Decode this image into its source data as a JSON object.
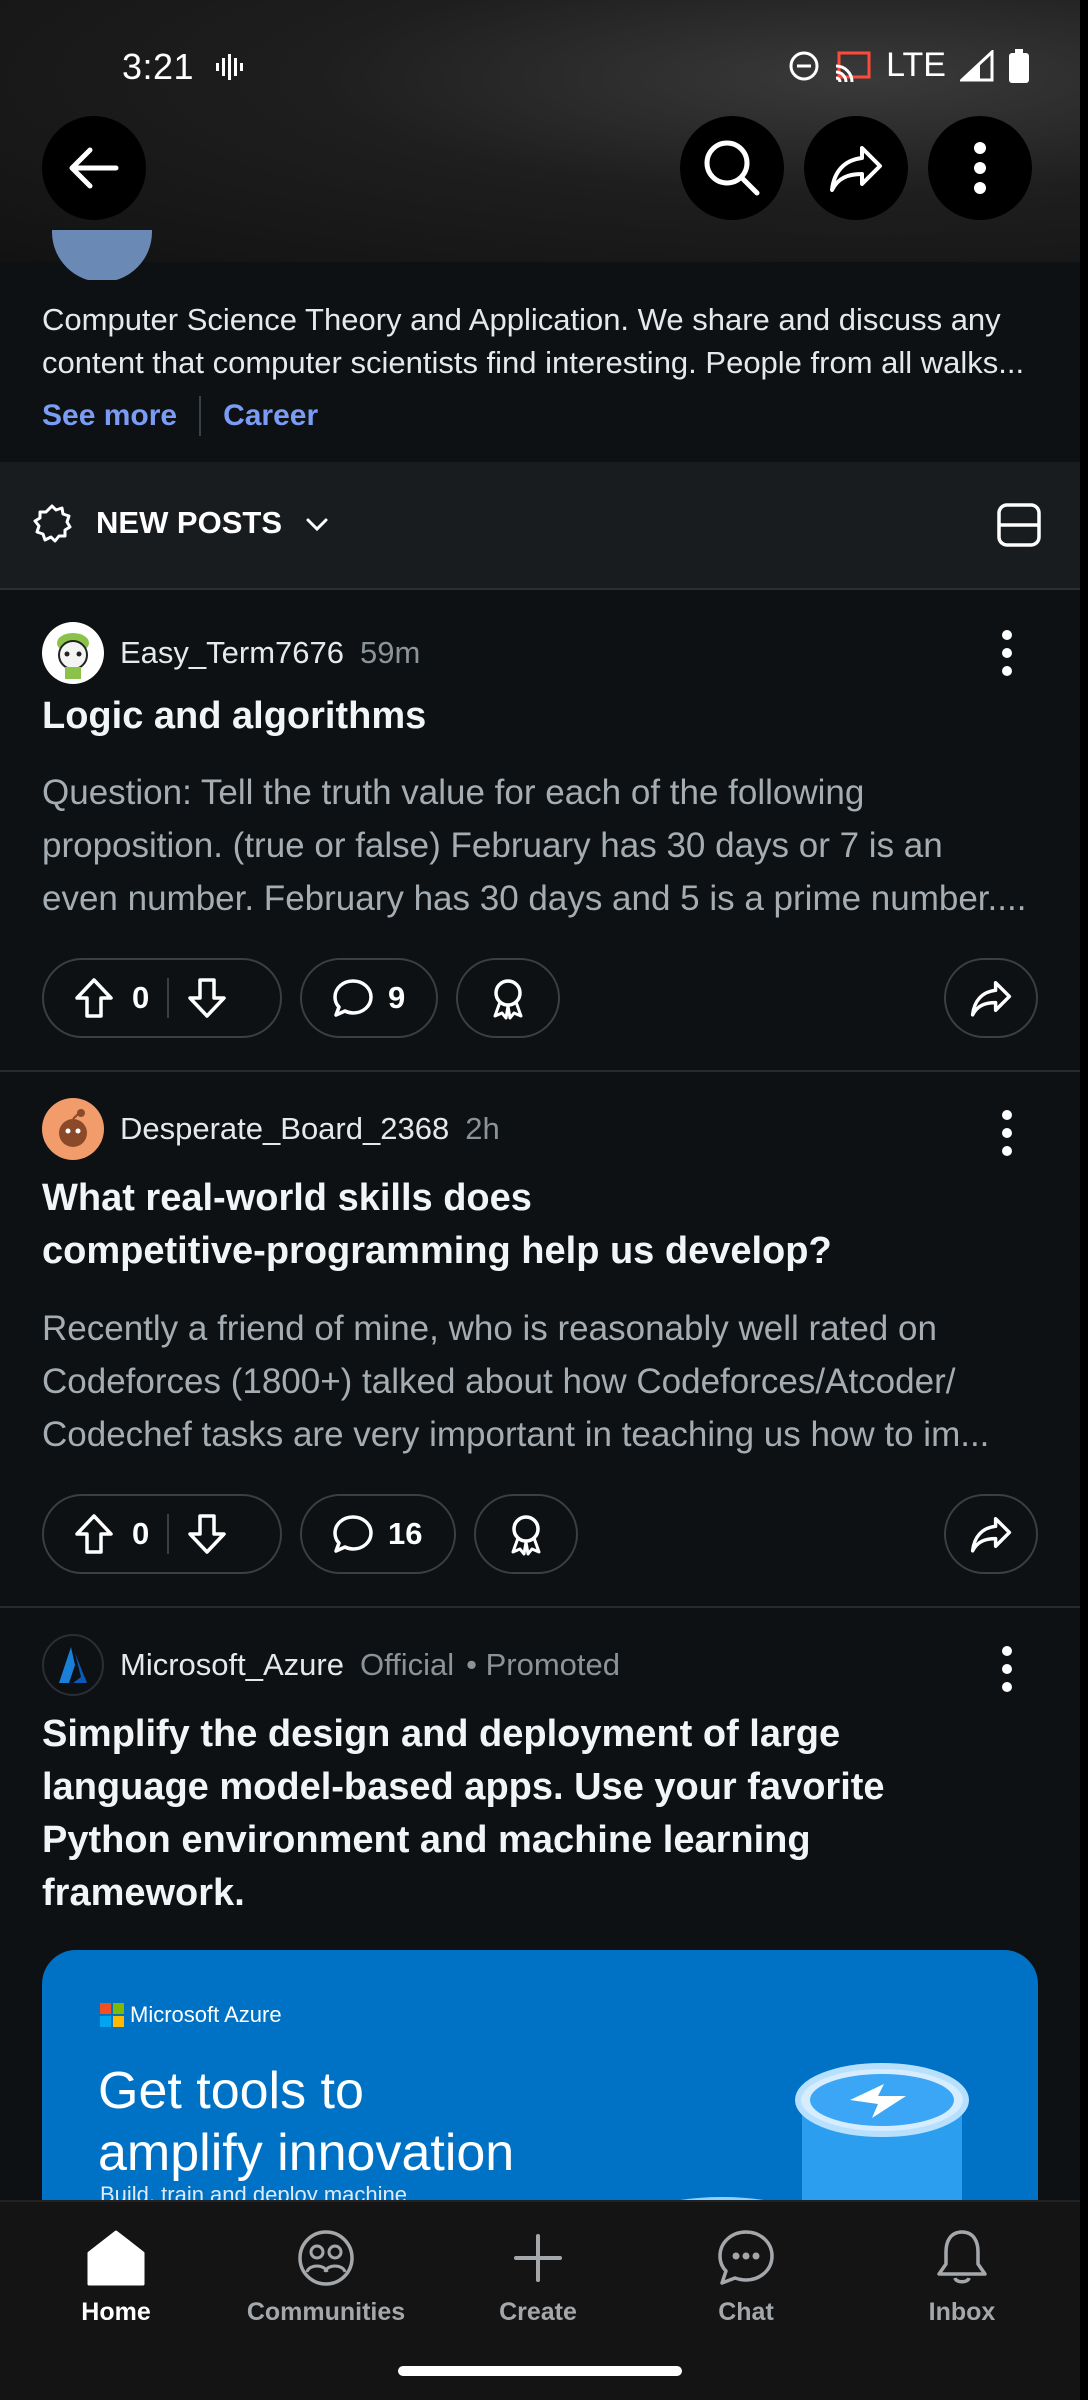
{
  "status": {
    "time": "3:21",
    "network": "LTE"
  },
  "community": {
    "description_line1": "Computer Science Theory and Application. We share and discuss any",
    "description_line2": "content that computer scientists find interesting. People from all walks...",
    "see_more": "See more",
    "link": "Career"
  },
  "sort": {
    "label": "NEW POSTS"
  },
  "posts": [
    {
      "author": "Easy_Term7676",
      "time": "59m",
      "title": "Logic and algorithms",
      "body": [
        "Question: Tell the truth value for each of the following",
        "proposition. (true or false) February has 30 days or 7 is an",
        "even number. February has 30 days and 5 is a prime number...."
      ],
      "votes": "0",
      "comments": "9"
    },
    {
      "author": "Desperate_Board_2368",
      "time": "2h",
      "title_line1": "What real-world skills does",
      "title_line2": "competitive-programming help us develop?",
      "body": [
        "Recently a friend of mine, who is reasonably well rated on",
        "Codeforces (1800+) talked about how Codeforces/Atcoder/",
        "Codechef tasks are very important in teaching us how to im..."
      ],
      "votes": "0",
      "comments": "16"
    }
  ],
  "ad": {
    "author": "Microsoft_Azure",
    "official": "Official",
    "promoted": "• Promoted",
    "title": [
      "Simplify the design and deployment of large",
      "language model-based apps. Use your favorite",
      "Python environment and machine learning",
      "framework."
    ],
    "card_brand": "Microsoft Azure",
    "card_headline_1": "Get tools to",
    "card_headline_2": "amplify innovation",
    "card_sub": "Build, train and deploy machine"
  },
  "nav": {
    "home": "Home",
    "communities": "Communities",
    "create": "Create",
    "chat": "Chat",
    "inbox": "Inbox"
  },
  "colors": {
    "background": "#0e1113",
    "link_blue": "#7a9cf5",
    "azure_blue": "#0072c6"
  }
}
